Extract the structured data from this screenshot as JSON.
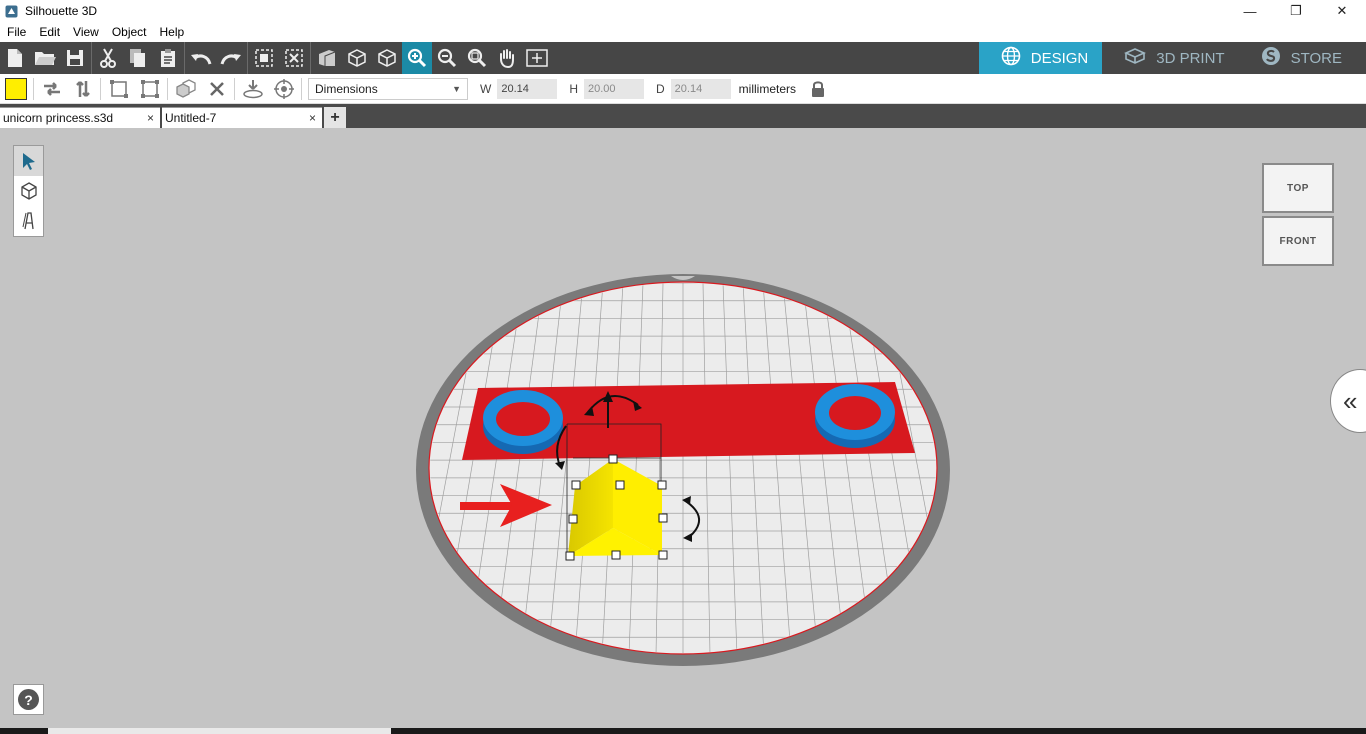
{
  "app": {
    "title": "Silhouette 3D"
  },
  "window_controls": {
    "minimize": "—",
    "maximize": "❐",
    "close": "✕"
  },
  "menu": [
    "File",
    "Edit",
    "View",
    "Object",
    "Help"
  ],
  "toolbar": {
    "icons": [
      "new-file-icon",
      "open-folder-icon",
      "save-icon",
      "cut-icon",
      "copy-icon",
      "paste-icon",
      "undo-icon",
      "redo-icon",
      "group-icon",
      "ungroup-icon",
      "perspective-icon",
      "box-view-icon",
      "box-outline-icon",
      "zoom-in-icon",
      "zoom-out-icon",
      "zoom-fit-icon",
      "pan-hand-icon",
      "frame-icon"
    ],
    "active": "zoom-in-icon"
  },
  "modes": [
    {
      "label": "DESIGN",
      "icon": "globe-icon",
      "active": true
    },
    {
      "label": "3D PRINT",
      "icon": "printer-icon",
      "active": false
    },
    {
      "label": "STORE",
      "icon": "store-s-icon",
      "active": false
    }
  ],
  "properties": {
    "color": "#ffee00",
    "dropdown_value": "Dimensions",
    "w_label": "W",
    "w_value": "20.14",
    "h_label": "H",
    "h_value": "20.00",
    "d_label": "D",
    "d_value": "20.14",
    "unit": "millimeters"
  },
  "tabs": [
    {
      "label": "unicorn princess.s3d",
      "close": "×"
    },
    {
      "label": "Untitled-7",
      "close": "×"
    }
  ],
  "add_tab": "+",
  "viewcube": {
    "top": "TOP",
    "front": "FRONT"
  },
  "collapse_label": "«",
  "help_label": "?",
  "colors": {
    "accent": "#2aa3c7",
    "toolbar_bg": "#464646",
    "viewport_bg": "#c4c4c4",
    "plate_red": "#d7191f",
    "ring_blue": "#1e8fdc",
    "pyramid_yellow": "#ffee00",
    "arrow_red": "#e8201f"
  }
}
